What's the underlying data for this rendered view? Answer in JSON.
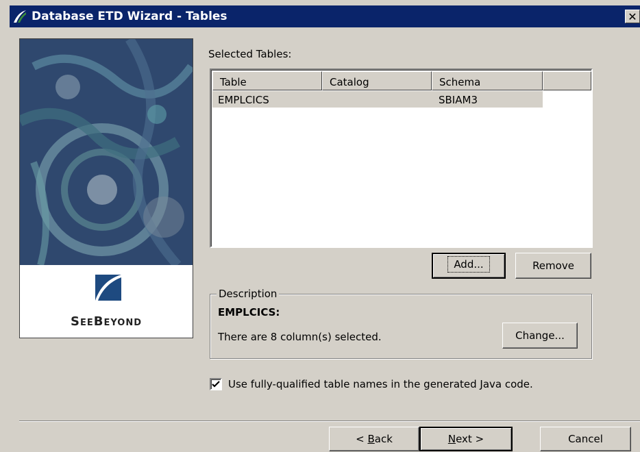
{
  "window": {
    "title": "Database ETD Wizard - Tables",
    "close_glyph": "✕"
  },
  "branding": {
    "logo_text": "SeeBeyond"
  },
  "selected_tables": {
    "label": "Selected Tables:",
    "columns": [
      "Table",
      "Catalog",
      "Schema",
      ""
    ],
    "rows": [
      {
        "table": "EMPLCICS",
        "catalog": "",
        "schema": "SBIAM3"
      }
    ]
  },
  "buttons": {
    "add": "Add...",
    "remove": "Remove",
    "change": "Change...",
    "back_prefix": "< ",
    "back_mnemonic": "B",
    "back_rest": "ack",
    "next_mnemonic": "N",
    "next_rest": "ext >",
    "cancel": "Cancel"
  },
  "description": {
    "group_label": "Description",
    "table_name": "EMPLCICS:",
    "text": "There are 8 column(s) selected."
  },
  "options": {
    "fully_qualified_label": "Use fully-qualified table names in the generated Java code.",
    "fully_qualified_checked": true
  },
  "colors": {
    "titlebar": "#0a246a",
    "dialog_background": "#d4d0c8"
  }
}
